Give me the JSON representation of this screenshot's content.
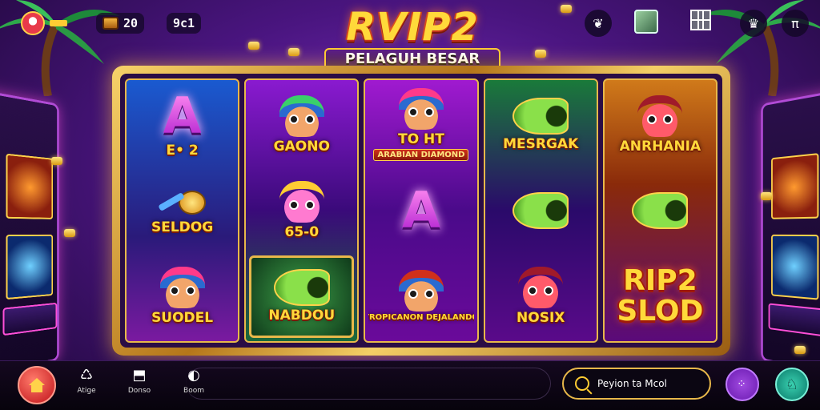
{
  "hud": {
    "coins": "20",
    "level": "9c1"
  },
  "title": {
    "main": "RVIP2",
    "subtitle": "PELAGUH BESAR"
  },
  "reels": [
    [
      {
        "type": "letter",
        "glyph": "A",
        "label": "E• 2"
      },
      {
        "type": "key",
        "label": "SELDOG"
      },
      {
        "type": "face",
        "variant": "pink-hat",
        "label": "SUODEL"
      }
    ],
    [
      {
        "type": "face",
        "variant": "green",
        "label": "GAONO"
      },
      {
        "type": "face",
        "variant": "pink",
        "label": "65-0"
      },
      {
        "type": "horn",
        "label": "NABDOU",
        "highlight": true
      }
    ],
    [
      {
        "type": "face",
        "variant": "blue",
        "label": "TO HT",
        "plate": "ARABIAN DIAMOND"
      },
      {
        "type": "letter",
        "glyph": "A",
        "label": ""
      },
      {
        "type": "face",
        "variant": "orange",
        "label": "TROPICANON DEJALANDO"
      }
    ],
    [
      {
        "type": "horn",
        "label": "MESRGAK"
      },
      {
        "type": "horn",
        "label": ""
      },
      {
        "type": "face",
        "variant": "red",
        "label": "NOSIX"
      }
    ],
    [
      {
        "type": "face",
        "variant": "red",
        "label": "ANRHANIA"
      },
      {
        "type": "horn",
        "label": ""
      },
      {
        "type": "text",
        "label": "RIP2 SLOD"
      }
    ]
  ],
  "bottom_nav": {
    "items": [
      {
        "label": "Atige",
        "icon": "♺"
      },
      {
        "label": "Donso",
        "icon": "⬒"
      },
      {
        "label": "Boom",
        "icon": "◐"
      }
    ],
    "search_label": "Peyion ta Mcol",
    "menu_glyph": "⁘",
    "profile_glyph": "♘"
  },
  "colors": {
    "gold": "#ffd93a",
    "purple_bg": "#4a1580",
    "accent_red": "#c0121a"
  }
}
